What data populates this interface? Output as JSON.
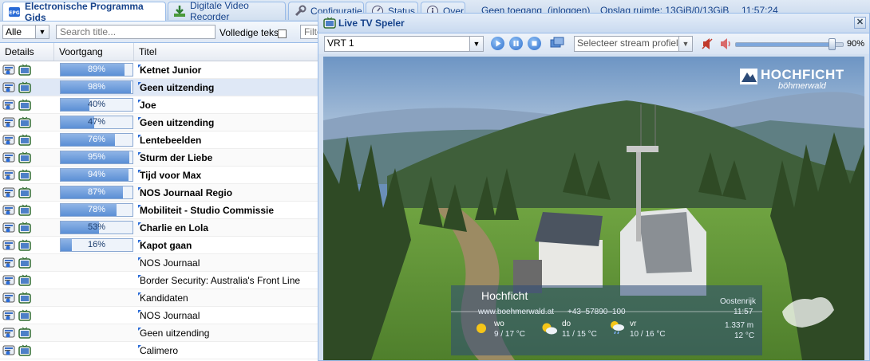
{
  "tabs": [
    {
      "label": "Electronische Programma Gids",
      "icon": "epg-icon",
      "active": true
    },
    {
      "label": "Digitale Video Recorder",
      "icon": "download-icon",
      "active": false
    },
    {
      "label": "Configuratie",
      "icon": "wrench-icon",
      "active": false
    },
    {
      "label": "Status",
      "icon": "status-icon",
      "active": false
    },
    {
      "label": "Over",
      "icon": "info-icon",
      "active": false
    }
  ],
  "status": {
    "access": "Geen toegang",
    "login": "(inloggen)",
    "storage": "Opslag ruimte: 13GiB/0/13GiB",
    "time": "11:57:24"
  },
  "epg": {
    "filter_value": "Alle",
    "search_placeholder": "Search title...",
    "fulltext_label": "Volledige tekst",
    "filter_placeholder": "Filte",
    "columns": {
      "details": "Details",
      "progress": "Voortgang",
      "title": "Titel"
    },
    "rows": [
      {
        "progress": "89%",
        "value": 89,
        "title": "Ketnet Junior",
        "bold": true
      },
      {
        "progress": "98%",
        "value": 98,
        "title": "Geen uitzending",
        "bold": true
      },
      {
        "progress": "40%",
        "value": 40,
        "title": "Joe",
        "bold": true
      },
      {
        "progress": "47%",
        "value": 47,
        "title": "Geen uitzending",
        "bold": true
      },
      {
        "progress": "76%",
        "value": 76,
        "title": "Lentebeelden",
        "bold": true
      },
      {
        "progress": "95%",
        "value": 95,
        "title": "Sturm der Liebe",
        "bold": true
      },
      {
        "progress": "94%",
        "value": 94,
        "title": "Tijd voor Max",
        "bold": true
      },
      {
        "progress": "87%",
        "value": 87,
        "title": "NOS Journaal Regio",
        "bold": true
      },
      {
        "progress": "78%",
        "value": 78,
        "title": "Mobiliteit - Studio Commissie",
        "bold": true
      },
      {
        "progress": "53%",
        "value": 53,
        "title": "Charlie en Lola",
        "bold": true
      },
      {
        "progress": "16%",
        "value": 16,
        "title": "Kapot gaan",
        "bold": true
      },
      {
        "progress": "",
        "value": null,
        "title": "NOS Journaal",
        "bold": false
      },
      {
        "progress": "",
        "value": null,
        "title": "Border Security: Australia's Front Line",
        "bold": false
      },
      {
        "progress": "",
        "value": null,
        "title": "Kandidaten",
        "bold": false
      },
      {
        "progress": "",
        "value": null,
        "title": "NOS Journaal",
        "bold": false
      },
      {
        "progress": "",
        "value": null,
        "title": "Geen uitzending",
        "bold": false
      },
      {
        "progress": "",
        "value": null,
        "title": "Calimero",
        "bold": false
      }
    ]
  },
  "player": {
    "title": "Live TV Speler",
    "channel": "VRT 1",
    "stream_profile_placeholder": "Selecteer stream profiel",
    "volume": "90%",
    "volume_level": 90,
    "video": {
      "logo_main": "HOCHFICHT",
      "logo_sub": "böhmerwald",
      "place": "Hochficht",
      "website": "www.boehmerwald.at",
      "phone": "+43–57890–100",
      "country": "Oostenrijk",
      "clock": "11:57",
      "altitude": "1.337 m",
      "temperature": "12 °C",
      "forecast": [
        {
          "day": "wo",
          "temps": "9 / 17 °C",
          "icon": "sun-icon"
        },
        {
          "day": "do",
          "temps": "11 / 15 °C",
          "icon": "sun-cloud-icon"
        },
        {
          "day": "vr",
          "temps": "10 / 16 °C",
          "icon": "sun-rain-icon"
        }
      ]
    }
  },
  "colors": {
    "accent": "#15428b",
    "progress": "#5b8fd5",
    "panel": "#d3e0f1"
  }
}
